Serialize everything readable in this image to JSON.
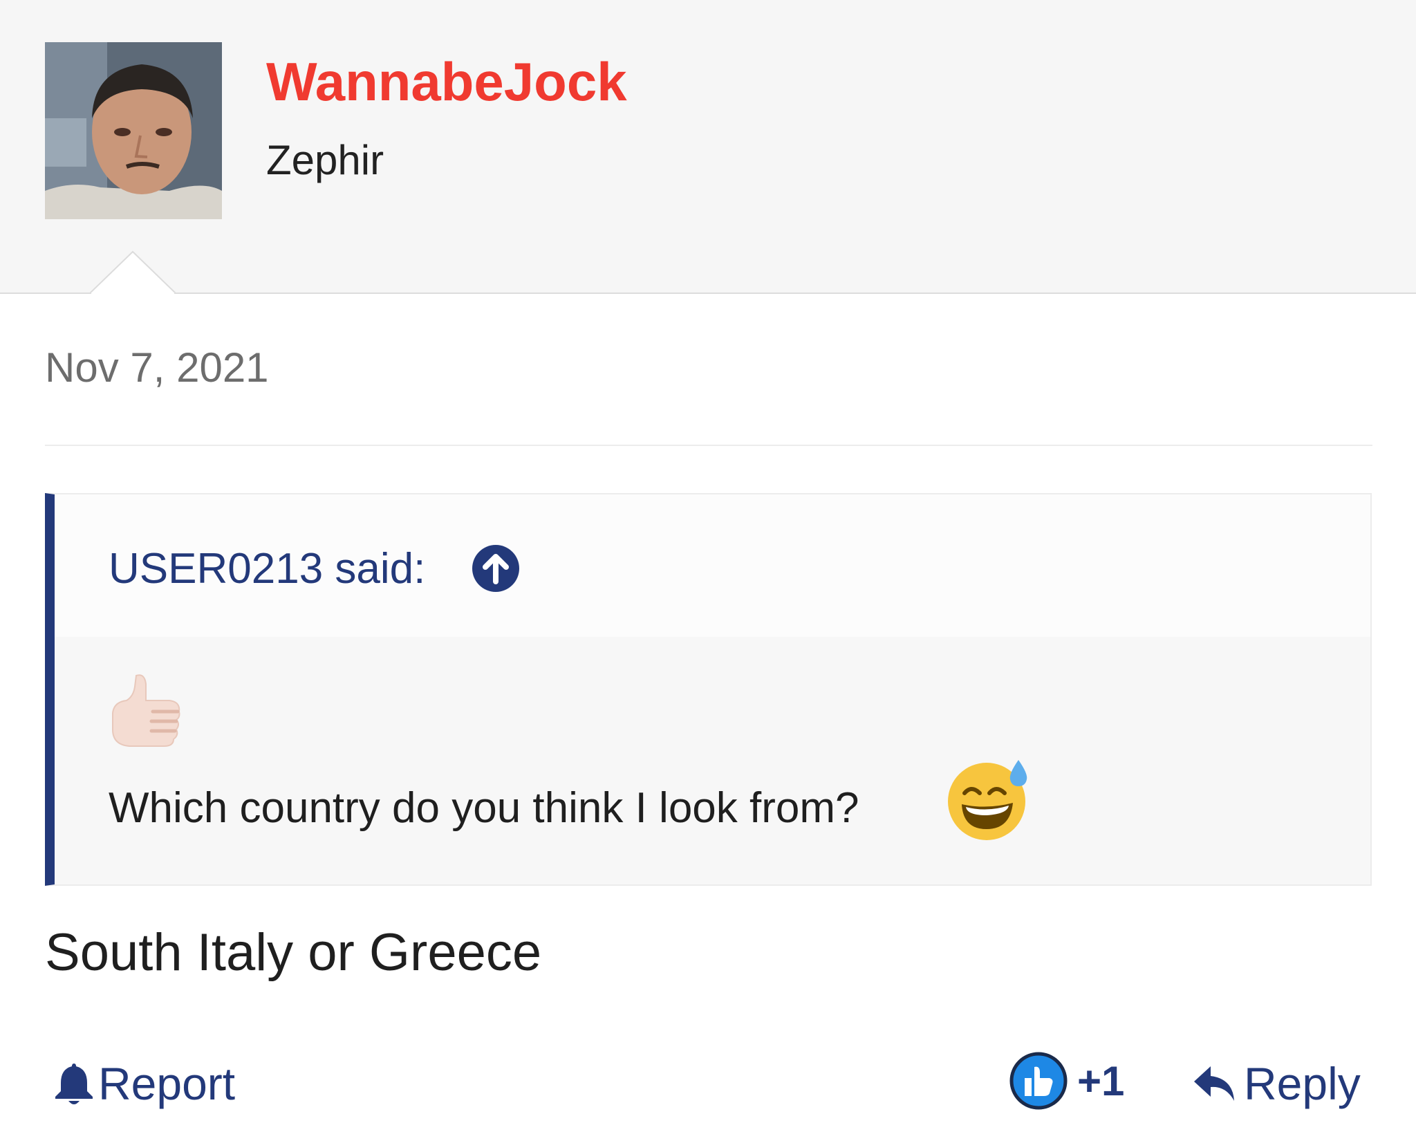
{
  "post": {
    "author": {
      "name": "WannabeJock",
      "title": "Zephir",
      "avatar_icon": "user-avatar-photo"
    },
    "date": "Nov 7, 2021",
    "quote": {
      "author_label": "USER0213 said:",
      "up_icon": "arrow-up-circle-icon",
      "emoji_icon": "thumbs-up-emoji",
      "text": "Which country do you think I look from?",
      "trailing_emoji": "grinning-sweat-emoji"
    },
    "body": "South Italy or Greece",
    "actions": {
      "report_label": "Report",
      "report_icon": "bell-icon",
      "like_count": "+1",
      "like_icon": "thumbs-up-badge-icon",
      "reply_label": "Reply",
      "reply_icon": "reply-arrow-icon"
    }
  },
  "colors": {
    "username": "#f03a30",
    "accent": "#23397a",
    "header_bg": "#f6f6f6",
    "like_badge": "#1e88e5"
  }
}
